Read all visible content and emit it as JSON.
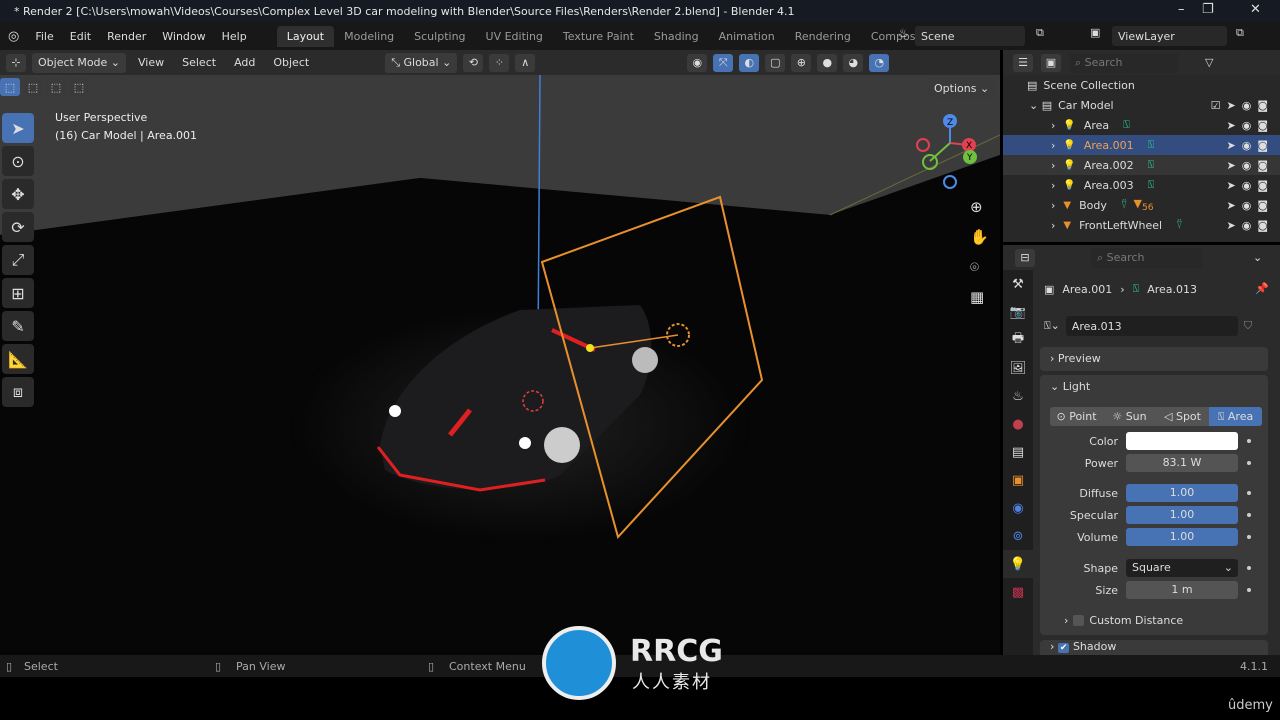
{
  "window": {
    "title": "* Render 2 [C:\\Users\\mowah\\Videos\\Courses\\Complex Level 3D car modeling with Blender\\Source Files\\Renders\\Render 2.blend] - Blender 4.1",
    "minimize": "–",
    "maximize": "❐",
    "close": "✕"
  },
  "menu": [
    "File",
    "Edit",
    "Render",
    "Window",
    "Help"
  ],
  "workspaces": [
    "Layout",
    "Modeling",
    "Sculpting",
    "UV Editing",
    "Texture Paint",
    "Shading",
    "Animation",
    "Rendering",
    "Compos"
  ],
  "scene": "Scene",
  "view_layer": "ViewLayer",
  "vp_header": {
    "mode": "Object Mode",
    "view": "View",
    "select": "Select",
    "add": "Add",
    "object": "Object",
    "orientation": "Global",
    "options": "Options"
  },
  "viewport": {
    "perspective": "User Perspective",
    "object": "(16) Car Model | Area.001",
    "gizmo": {
      "x": "X",
      "y": "Y",
      "z": "Z"
    }
  },
  "outliner": {
    "search_placeholder": "Search",
    "root": "Scene Collection",
    "collection": "Car Model",
    "items": [
      {
        "name": "Area",
        "type": "light"
      },
      {
        "name": "Area.001",
        "type": "light",
        "selected": true
      },
      {
        "name": "Area.002",
        "type": "light",
        "hover": true
      },
      {
        "name": "Area.003",
        "type": "light"
      },
      {
        "name": "Body",
        "type": "mesh",
        "badge": "56"
      },
      {
        "name": "FrontLeftWheel",
        "type": "mesh"
      }
    ]
  },
  "properties": {
    "search_placeholder": "Search",
    "breadcrumb_object": "Area.001",
    "breadcrumb_data": "Area.013",
    "datablock": "Area.013",
    "preview": "Preview",
    "light": "Light",
    "light_types": [
      "Point",
      "Sun",
      "Spot",
      "Area"
    ],
    "active_type": "Area",
    "fields": {
      "color_label": "Color",
      "color": "#ffffff",
      "power_label": "Power",
      "power": "83.1 W",
      "diffuse_label": "Diffuse",
      "diffuse": "1.00",
      "specular_label": "Specular",
      "specular": "1.00",
      "volume_label": "Volume",
      "volume": "1.00",
      "shape_label": "Shape",
      "shape": "Square",
      "size_label": "Size",
      "size": "1 m"
    },
    "custom_distance": "Custom Distance",
    "shadow": "Shadow",
    "shadow_checked": true
  },
  "status": {
    "select": "Select",
    "pan": "Pan View",
    "context": "Context Menu",
    "version": "4.1.1"
  },
  "watermark": {
    "logo": "RRCG",
    "sub": "人人素材"
  },
  "udemy": "ûdemy",
  "colors": {
    "accent": "#4772b3",
    "selection_orange": "#e8902e",
    "light_green": "#2fbf8f"
  }
}
